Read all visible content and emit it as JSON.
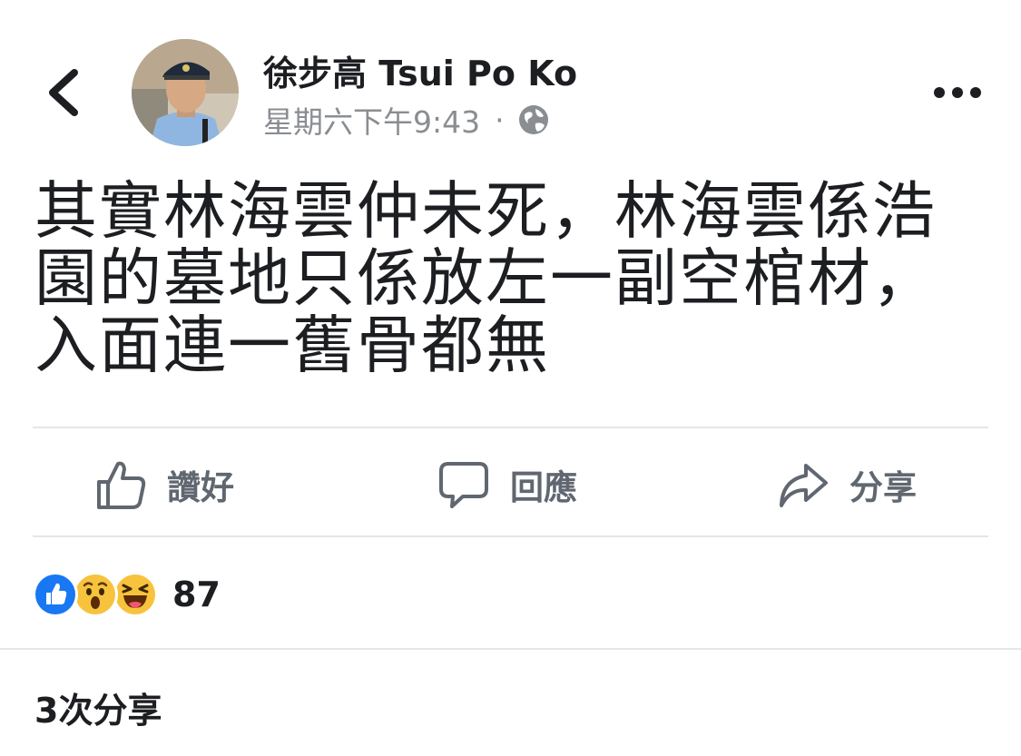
{
  "header": {
    "author_name": "徐步高 Tsui Po Ko",
    "timestamp": "星期六下午9:43",
    "separator": "·",
    "privacy_icon": "globe-icon",
    "back_icon": "chevron-left-icon",
    "more_icon": "more-horizontal-icon"
  },
  "post": {
    "text": "其實林海雲仲未死，林海雲係浩園的墓地只係放左一副空棺材，入面連一舊骨都無"
  },
  "actions": {
    "like_label": "讚好",
    "comment_label": "回應",
    "share_label": "分享"
  },
  "reactions": {
    "types": [
      "like",
      "wow",
      "haha"
    ],
    "count": "87"
  },
  "shares_text": "3次分享",
  "colors": {
    "text": "#1c1e21",
    "secondary": "#606770",
    "meta": "#8a8d91",
    "like_blue": "#1877f2",
    "emoji_yellow": "#f7c33d"
  }
}
